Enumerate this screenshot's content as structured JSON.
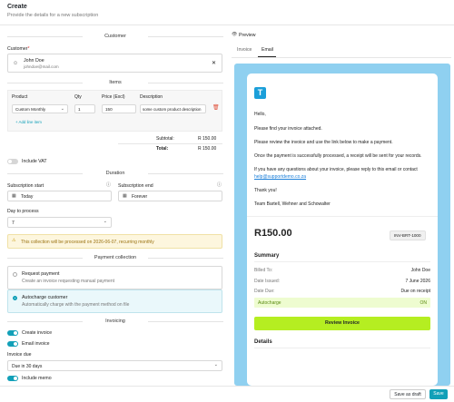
{
  "header": {
    "title": "Create",
    "subtitle": "Provide the details for a new subscription"
  },
  "customer": {
    "section": "Customer",
    "label": "Customer",
    "required_mark": "*",
    "name": "John Doe",
    "email": "johndoe@mail.com"
  },
  "items": {
    "section": "Items",
    "columns": [
      "Product",
      "Qty",
      "Price (Excl)",
      "Description"
    ],
    "row": {
      "product": "Custom Monthly",
      "qty": "1",
      "price": "150",
      "description": "some custom product description"
    },
    "add_label": "+ Add line item",
    "subtotal_label": "Subtotal:",
    "subtotal": "R 150.00",
    "total_label": "Total:",
    "total": "R 150.00"
  },
  "vat": {
    "label": "Include VAT",
    "on": false
  },
  "duration": {
    "section": "Duration",
    "start_label": "Subscription start",
    "start_value": "Today",
    "end_label": "Subscription end",
    "end_value": "Forever",
    "day_label": "Day to process",
    "day_value": "7",
    "notice": "This collection will be processed on 2026-06-07, recurring monthly"
  },
  "payment": {
    "section": "Payment collection",
    "opt1_title": "Request payment",
    "opt1_desc": "Create an invoice requesting manual payment",
    "opt2_title": "Autocharge customer",
    "opt2_desc": "Automatically charge with the payment method on file",
    "selected": "autocharge"
  },
  "invoicing": {
    "section": "Invoicing",
    "create_label": "Create invoice",
    "email_label": "Email invoice",
    "due_label": "Invoice due",
    "due_value": "Due in 30 days",
    "memo_label": "Include memo"
  },
  "preview": {
    "title": "Preview",
    "tabs": [
      "Invoice",
      "Email"
    ],
    "active_tab": "Email"
  },
  "email": {
    "greeting": "Hello,",
    "p1": "Please find your invoice attached.",
    "p2": "Please review the invoice and use the link below to make a payment.",
    "p3": "Once the payment is successfully processed, a receipt will be sent for your records.",
    "p4": "If you have any questions about your invoice, please reply to this email or contact",
    "link": "help@supportdemo.co.za",
    "thanks": "Thank you!",
    "team": "Team Bartell, Wehner and Schowalter",
    "amount": "R150.00",
    "invoice_no": "INV-BRT-1000",
    "summary": "Summary",
    "billed_to_label": "Billed To:",
    "billed_to": "John Doe",
    "issued_label": "Date Issued:",
    "issued": "7 June 2026",
    "due_label": "Date Due:",
    "due": "Due on receipt",
    "auto_label": "Autocharge",
    "auto_value": "ON",
    "review": "Review Invoice",
    "details": "Details"
  },
  "colors": {
    "accent": "#12a0b8",
    "preview_bg": "#8fd0f0",
    "lime": "#b5ee21"
  },
  "footer": {
    "draft": "Save as draft",
    "save": "Save"
  }
}
